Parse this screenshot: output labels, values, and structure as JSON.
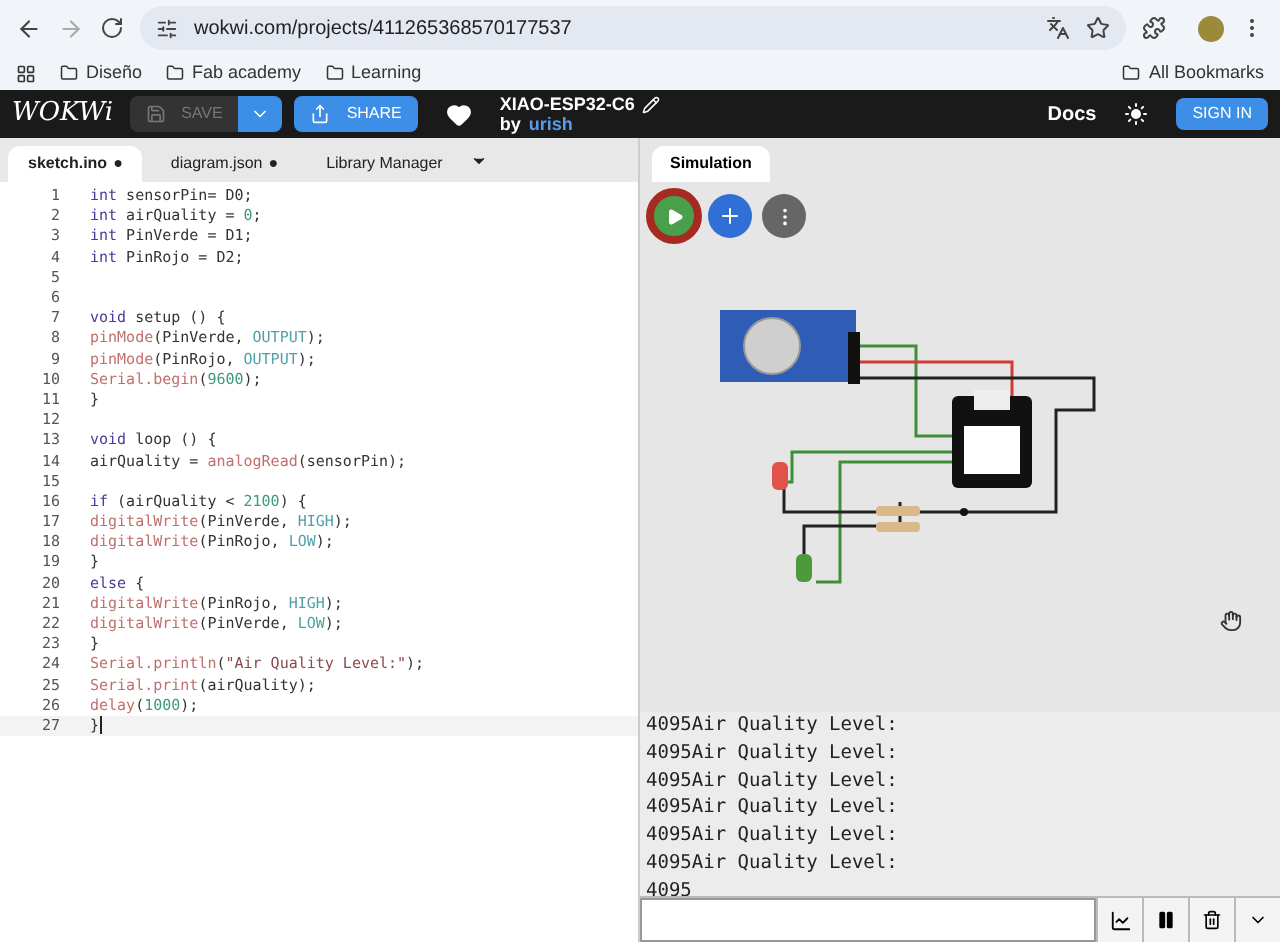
{
  "browser": {
    "url": "wokwi.com/projects/411265368570177537",
    "bookmarks": [
      "Diseño",
      "Fab academy",
      "Learning"
    ],
    "all_bookmarks": "All Bookmarks"
  },
  "header": {
    "logo": "WOKWi",
    "save": {
      "label": "SAVE",
      "disabled": true
    },
    "share": "SHARE",
    "project_title": "XIAO-ESP32-C6",
    "by": "by",
    "author": "urish",
    "docs": "Docs",
    "sign_in": "SIGN IN"
  },
  "modified_indicator": "●",
  "editor_tabs": [
    {
      "label": "sketch.ino",
      "modified": true,
      "selected": true
    },
    {
      "label": "diagram.json",
      "modified": true,
      "selected": false
    },
    {
      "label": "Library Manager",
      "modified": false,
      "selected": false
    }
  ],
  "code_lines": [
    {
      "no": "1",
      "current": false,
      "tokens": [
        {
          "text": "int",
          "kind": "kw"
        },
        {
          "text": " sensorPin= D0;",
          "kind": "plain"
        }
      ]
    },
    {
      "no": "2",
      "current": false,
      "tokens": [
        {
          "text": "int",
          "kind": "kw"
        },
        {
          "text": " airQuality = ",
          "kind": "plain"
        },
        {
          "text": "0",
          "kind": "num"
        },
        {
          "text": ";",
          "kind": "plain"
        }
      ]
    },
    {
      "no": "3",
      "current": false,
      "tokens": [
        {
          "text": "int",
          "kind": "kw"
        },
        {
          "text": " PinVerde = D1;",
          "kind": "plain"
        }
      ]
    },
    {
      "no": "4",
      "current": false,
      "tokens": [
        {
          "text": "int",
          "kind": "kw"
        },
        {
          "text": " PinRojo = D2;",
          "kind": "plain"
        }
      ]
    },
    {
      "no": "5",
      "current": false
    },
    {
      "no": "6",
      "current": false
    },
    {
      "no": "7",
      "current": false,
      "tokens": [
        {
          "text": "void",
          "kind": "kw"
        },
        {
          "text": " setup () {",
          "kind": "plain"
        }
      ]
    },
    {
      "no": "8",
      "current": false,
      "tokens": [
        {
          "text": "pinMode",
          "kind": "fn"
        },
        {
          "text": "(PinVerde, ",
          "kind": "plain"
        },
        {
          "text": "OUTPUT",
          "kind": "const"
        },
        {
          "text": ");",
          "kind": "plain"
        }
      ]
    },
    {
      "no": "9",
      "current": false,
      "tokens": [
        {
          "text": "pinMode",
          "kind": "fn"
        },
        {
          "text": "(PinRojo, ",
          "kind": "plain"
        },
        {
          "text": "OUTPUT",
          "kind": "const"
        },
        {
          "text": ");",
          "kind": "plain"
        }
      ]
    },
    {
      "no": "10",
      "current": false,
      "tokens": [
        {
          "text": "Serial.begin",
          "kind": "fn"
        },
        {
          "text": "(",
          "kind": "plain"
        },
        {
          "text": "9600",
          "kind": "num"
        },
        {
          "text": ");",
          "kind": "plain"
        }
      ]
    },
    {
      "no": "11",
      "current": false,
      "tokens": [
        {
          "text": "}",
          "kind": "plain"
        }
      ]
    },
    {
      "no": "12",
      "current": false
    },
    {
      "no": "13",
      "current": false,
      "tokens": [
        {
          "text": "void",
          "kind": "kw"
        },
        {
          "text": " loop () {",
          "kind": "plain"
        }
      ]
    },
    {
      "no": "14",
      "current": false,
      "tokens": [
        {
          "text": "airQuality = ",
          "kind": "plain"
        },
        {
          "text": "analogRead",
          "kind": "fn"
        },
        {
          "text": "(sensorPin);",
          "kind": "plain"
        }
      ]
    },
    {
      "no": "15",
      "current": false
    },
    {
      "no": "16",
      "current": false,
      "tokens": [
        {
          "text": "if",
          "kind": "kw"
        },
        {
          "text": " (airQuality < ",
          "kind": "plain"
        },
        {
          "text": "2100",
          "kind": "num"
        },
        {
          "text": ") {",
          "kind": "plain"
        }
      ]
    },
    {
      "no": "17",
      "current": false,
      "tokens": [
        {
          "text": "digitalWrite",
          "kind": "fn"
        },
        {
          "text": "(PinVerde, ",
          "kind": "plain"
        },
        {
          "text": "HIGH",
          "kind": "const"
        },
        {
          "text": ");",
          "kind": "plain"
        }
      ]
    },
    {
      "no": "18",
      "current": false,
      "tokens": [
        {
          "text": "digitalWrite",
          "kind": "fn"
        },
        {
          "text": "(PinRojo, ",
          "kind": "plain"
        },
        {
          "text": "LOW",
          "kind": "const"
        },
        {
          "text": ");",
          "kind": "plain"
        }
      ]
    },
    {
      "no": "19",
      "current": false,
      "tokens": [
        {
          "text": "}",
          "kind": "plain"
        }
      ]
    },
    {
      "no": "20",
      "current": false,
      "tokens": [
        {
          "text": "else",
          "kind": "kw"
        },
        {
          "text": " {",
          "kind": "plain"
        }
      ]
    },
    {
      "no": "21",
      "current": false,
      "tokens": [
        {
          "text": "digitalWrite",
          "kind": "fn"
        },
        {
          "text": "(PinRojo, ",
          "kind": "plain"
        },
        {
          "text": "HIGH",
          "kind": "const"
        },
        {
          "text": ");",
          "kind": "plain"
        }
      ]
    },
    {
      "no": "22",
      "current": false,
      "tokens": [
        {
          "text": "digitalWrite",
          "kind": "fn"
        },
        {
          "text": "(PinVerde, ",
          "kind": "plain"
        },
        {
          "text": "LOW",
          "kind": "const"
        },
        {
          "text": ");",
          "kind": "plain"
        }
      ]
    },
    {
      "no": "23",
      "current": false,
      "tokens": [
        {
          "text": "}",
          "kind": "plain"
        }
      ]
    },
    {
      "no": "24",
      "current": false,
      "tokens": [
        {
          "text": "Serial.println",
          "kind": "fn"
        },
        {
          "text": "(",
          "kind": "plain"
        },
        {
          "text": "\"Air Quality Level:\"",
          "kind": "str"
        },
        {
          "text": ");",
          "kind": "plain"
        }
      ]
    },
    {
      "no": "25",
      "current": false,
      "tokens": [
        {
          "text": "Serial.print",
          "kind": "fn"
        },
        {
          "text": "(airQuality);",
          "kind": "plain"
        }
      ]
    },
    {
      "no": "26",
      "current": false,
      "tokens": [
        {
          "text": "delay",
          "kind": "fn"
        },
        {
          "text": "(",
          "kind": "plain"
        },
        {
          "text": "1000",
          "kind": "num"
        },
        {
          "text": ");",
          "kind": "plain"
        }
      ]
    },
    {
      "no": "27",
      "current": true,
      "tokens": [
        {
          "text": "}",
          "kind": "plain"
        }
      ]
    }
  ],
  "simulation_tab": "Simulation",
  "serial_output": [
    "4095Air Quality Level:",
    "4095Air Quality Level:",
    "4095Air Quality Level:",
    "4095Air Quality Level:",
    "4095Air Quality Level:",
    "4095Air Quality Level:",
    "4095"
  ]
}
